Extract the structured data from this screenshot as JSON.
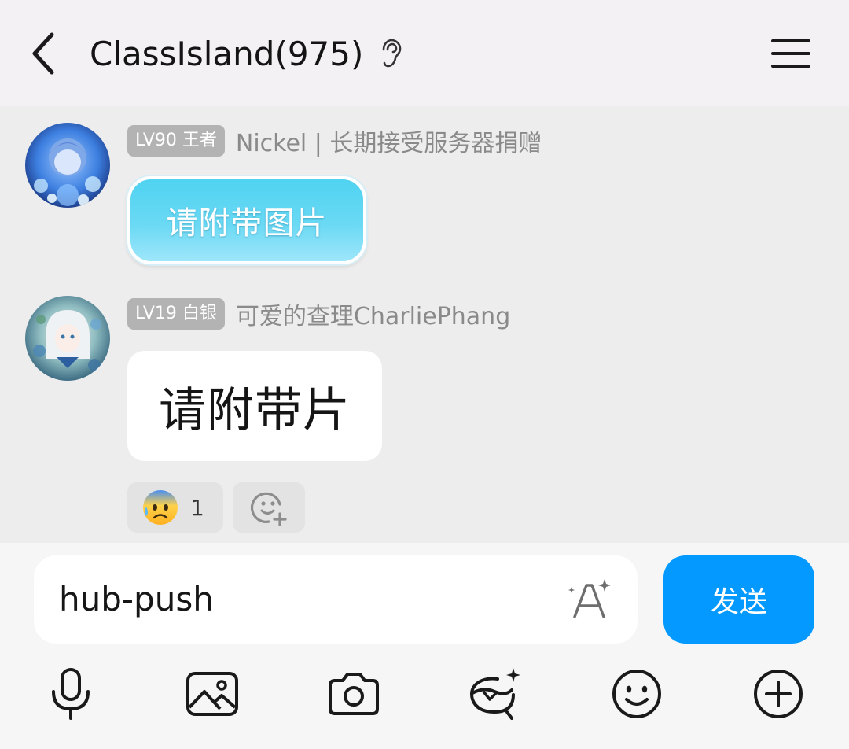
{
  "header": {
    "title": "ClassIsland(975)",
    "back_icon": "chevron-left-icon",
    "ear_icon": "ear-icon",
    "menu_icon": "hamburger-menu-icon"
  },
  "messages": [
    {
      "level": "LV90 王者",
      "sender": "Nickel | 长期接受服务器捐赠",
      "text": "请附带图片",
      "bubble_style": "fancy-cyan",
      "avatar": "avatar-blue-anime"
    },
    {
      "level": "LV19 白银",
      "sender": "可爱的查理CharliePhang",
      "text": "请附带片",
      "bubble_style": "plain-white",
      "avatar": "avatar-white-hair-anime",
      "reactions": [
        {
          "emoji": "😰",
          "count": "1"
        }
      ],
      "add_reaction_icon": "add-reaction-icon"
    }
  ],
  "composer": {
    "input_value": "hub-push",
    "font_icon": "ai-font-icon",
    "send_label": "发送"
  },
  "toolbar": {
    "items": [
      "microphone-icon",
      "image-icon",
      "camera-icon",
      "sticker-icon",
      "emoji-icon",
      "plus-circle-icon"
    ]
  },
  "colors": {
    "accent": "#0399ff",
    "header_bg": "#f4f1f4",
    "chat_bg": "#ededed",
    "badge_bg": "#b3b3b3"
  }
}
